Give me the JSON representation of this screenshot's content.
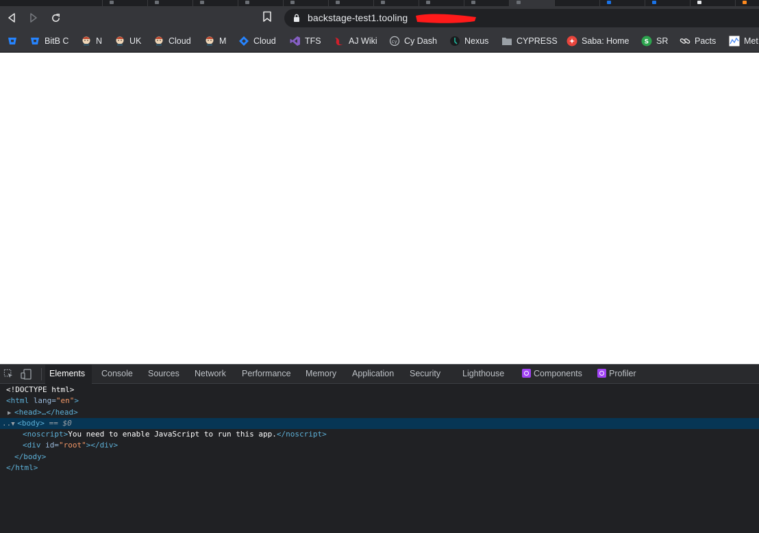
{
  "browser": {
    "url": "backstage-test1.tooling",
    "bookmarks": [
      {
        "label": "",
        "icon": "bitbucket-icon"
      },
      {
        "label": "BitB C",
        "icon": "bitbucket-icon"
      },
      {
        "label": "N",
        "icon": "jenkins-icon"
      },
      {
        "label": "UK",
        "icon": "jenkins-icon"
      },
      {
        "label": "Cloud",
        "icon": "jenkins-icon"
      },
      {
        "label": "M",
        "icon": "jenkins-icon"
      },
      {
        "label": "Cloud",
        "icon": "jira-icon"
      },
      {
        "label": "TFS",
        "icon": "visual-studio-icon"
      },
      {
        "label": "AJ Wiki",
        "icon": "wiki-icon"
      },
      {
        "label": "Cy Dash",
        "icon": "cypress-icon"
      },
      {
        "label": "Nexus",
        "icon": "nexus-icon"
      },
      {
        "label": "CYPRESS",
        "icon": "folder-icon"
      },
      {
        "label": "Saba: Home",
        "icon": "saba-icon"
      },
      {
        "label": "SR",
        "icon": "sr-icon"
      },
      {
        "label": "Pacts",
        "icon": "link-icon"
      },
      {
        "label": "Met",
        "icon": "chart-icon"
      }
    ]
  },
  "devtools": {
    "tabs": [
      "Elements",
      "Console",
      "Sources",
      "Network",
      "Performance",
      "Memory",
      "Application",
      "Security",
      "Lighthouse",
      "Components",
      "Profiler"
    ],
    "active_tab": "Elements",
    "dom": {
      "doctype": "<!DOCTYPE html>",
      "html_open": "<html",
      "lang_attr": "lang",
      "lang_val": "\"en\"",
      "head": "<head>…</head>",
      "body_open": "<body>",
      "selected_marker": "== $0",
      "noscript_open": "<noscript>",
      "noscript_text": "You need to enable JavaScript to run this app.",
      "noscript_close": "</noscript>",
      "div_open": "<div",
      "id_attr": "id",
      "id_val": "\"root\"",
      "div_close": "></div>",
      "body_close": "</body>",
      "html_close": "</html>"
    }
  },
  "colors": {
    "toolbar": "#35363a",
    "devtools_bg": "#202124",
    "selected_row": "#073655",
    "redaction": "#ff1a1a"
  }
}
